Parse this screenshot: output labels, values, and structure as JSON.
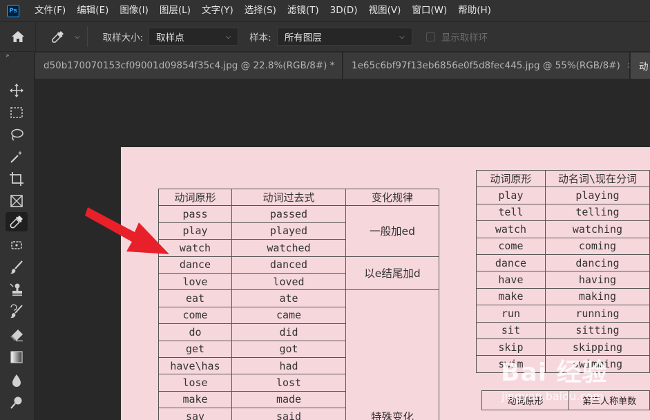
{
  "app": {
    "logo_text": "Ps"
  },
  "menu": [
    "文件(F)",
    "编辑(E)",
    "图像(I)",
    "图层(L)",
    "文字(Y)",
    "选择(S)",
    "滤镜(T)",
    "3D(D)",
    "视图(V)",
    "窗口(W)",
    "帮助(H)"
  ],
  "options": {
    "sample_size_label": "取样大小:",
    "sample_size_value": "取样点",
    "sample_label": "样本:",
    "sample_value": "所有图层",
    "show_ring_label": "显示取样环"
  },
  "tabs": [
    {
      "label": "d50b170070153cf09001d09854f35c4.jpg @ 22.8%(RGB/8#) *"
    },
    {
      "label": "1e65c6bf97f13eb6856e0f5d8fec445.jpg @ 55%(RGB/8#)"
    },
    {
      "label": "动"
    }
  ],
  "toolbar_collapse": "»",
  "table1": {
    "headers": [
      "动词原形",
      "动词过去式",
      "变化规律"
    ],
    "rows": [
      [
        "pass",
        "passed"
      ],
      [
        "play",
        "played"
      ],
      [
        "watch",
        "watched"
      ],
      [
        "dance",
        "danced"
      ],
      [
        "love",
        "loved"
      ],
      [
        "eat",
        "ate"
      ],
      [
        "come",
        "came"
      ],
      [
        "do",
        "did"
      ],
      [
        "get",
        "got"
      ],
      [
        "have\\has",
        "had"
      ],
      [
        "lose",
        "lost"
      ],
      [
        "make",
        "made"
      ],
      [
        "say",
        "said"
      ]
    ],
    "rules": [
      "一般加ed",
      "以e结尾加d",
      "特殊变化"
    ]
  },
  "table2": {
    "headers": [
      "动词原形",
      "动名词\\现在分词"
    ],
    "rows": [
      [
        "play",
        "playing"
      ],
      [
        "tell",
        "telling"
      ],
      [
        "watch",
        "watching"
      ],
      [
        "come",
        "coming"
      ],
      [
        "dance",
        "dancing"
      ],
      [
        "have",
        "having"
      ],
      [
        "make",
        "making"
      ],
      [
        "run",
        "running"
      ],
      [
        "sit",
        "sitting"
      ],
      [
        "skip",
        "skipping"
      ],
      [
        "swim",
        "swimming"
      ]
    ]
  },
  "table3": {
    "headers": [
      "动词原形",
      "第三人称单数"
    ]
  },
  "watermark": {
    "logo": "Bai 经验",
    "url": "jingyan.baidu.com"
  },
  "colors": {
    "accent_red": "#e8202a",
    "document_bg": "#f6d7dc"
  }
}
